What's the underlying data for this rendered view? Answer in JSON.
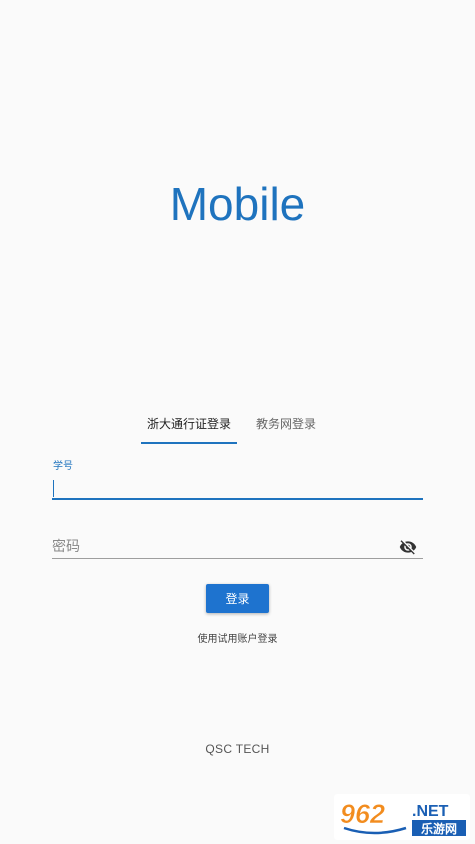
{
  "app": {
    "title": "Mobile"
  },
  "tabs": [
    {
      "label": "浙大通行证登录",
      "active": true
    },
    {
      "label": "教务网登录",
      "active": false
    }
  ],
  "form": {
    "username_label": "学号",
    "username_value": "",
    "password_placeholder": "密码",
    "password_value": "",
    "submit_label": "登录",
    "trial_link": "使用试用账户登录"
  },
  "footer": {
    "text": "QSC TECH"
  },
  "watermark": {
    "number": "962",
    "suffix": ".NET",
    "name": "乐游网"
  },
  "icons": {
    "password_toggle": "eye-off-icon"
  },
  "colors": {
    "primary": "#1e73be",
    "button": "#1e73cf",
    "background": "#fafafa"
  }
}
